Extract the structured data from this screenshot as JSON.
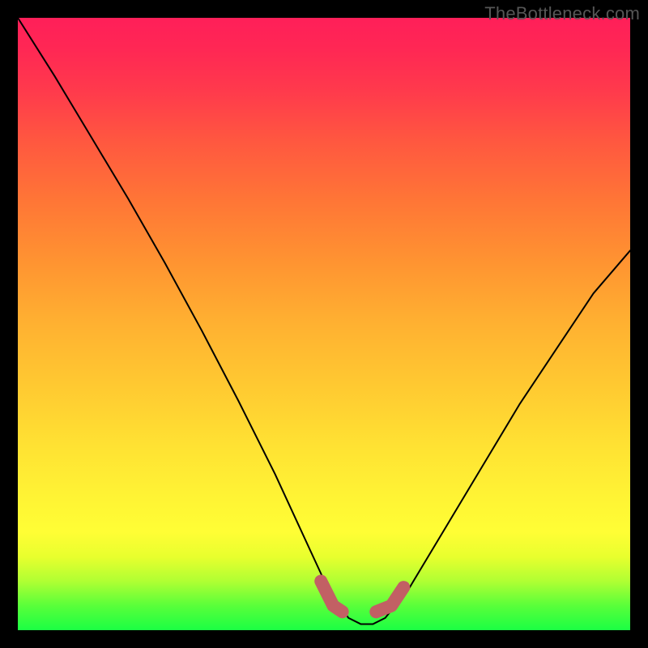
{
  "watermark": "TheBottleneck.com",
  "chart_data": {
    "type": "line",
    "title": "",
    "xlabel": "",
    "ylabel": "",
    "xlim": [
      0,
      100
    ],
    "ylim": [
      0,
      100
    ],
    "background_gradient": {
      "top_color": "#ff1f59",
      "bottom_color": "#1bff44",
      "stops": [
        "red",
        "orange",
        "yellow",
        "green"
      ]
    },
    "series": [
      {
        "name": "bottleneck-curve",
        "x": [
          0,
          6,
          12,
          18,
          24,
          30,
          36,
          42,
          48,
          51,
          54,
          56,
          58,
          60,
          64,
          70,
          76,
          82,
          88,
          94,
          100
        ],
        "y": [
          100,
          90.5,
          80.5,
          70.5,
          60,
          49,
          37.5,
          25.5,
          12.5,
          6,
          2,
          1,
          1,
          2,
          7,
          17,
          27,
          37,
          46,
          55,
          62
        ]
      }
    ],
    "highlights": [
      {
        "name": "left-floor-dash",
        "x": [
          49.5,
          51.5,
          53
        ],
        "y": [
          8,
          4,
          3
        ]
      },
      {
        "name": "right-floor-dash",
        "x": [
          58.5,
          61,
          63
        ],
        "y": [
          3,
          4,
          7
        ]
      }
    ]
  }
}
